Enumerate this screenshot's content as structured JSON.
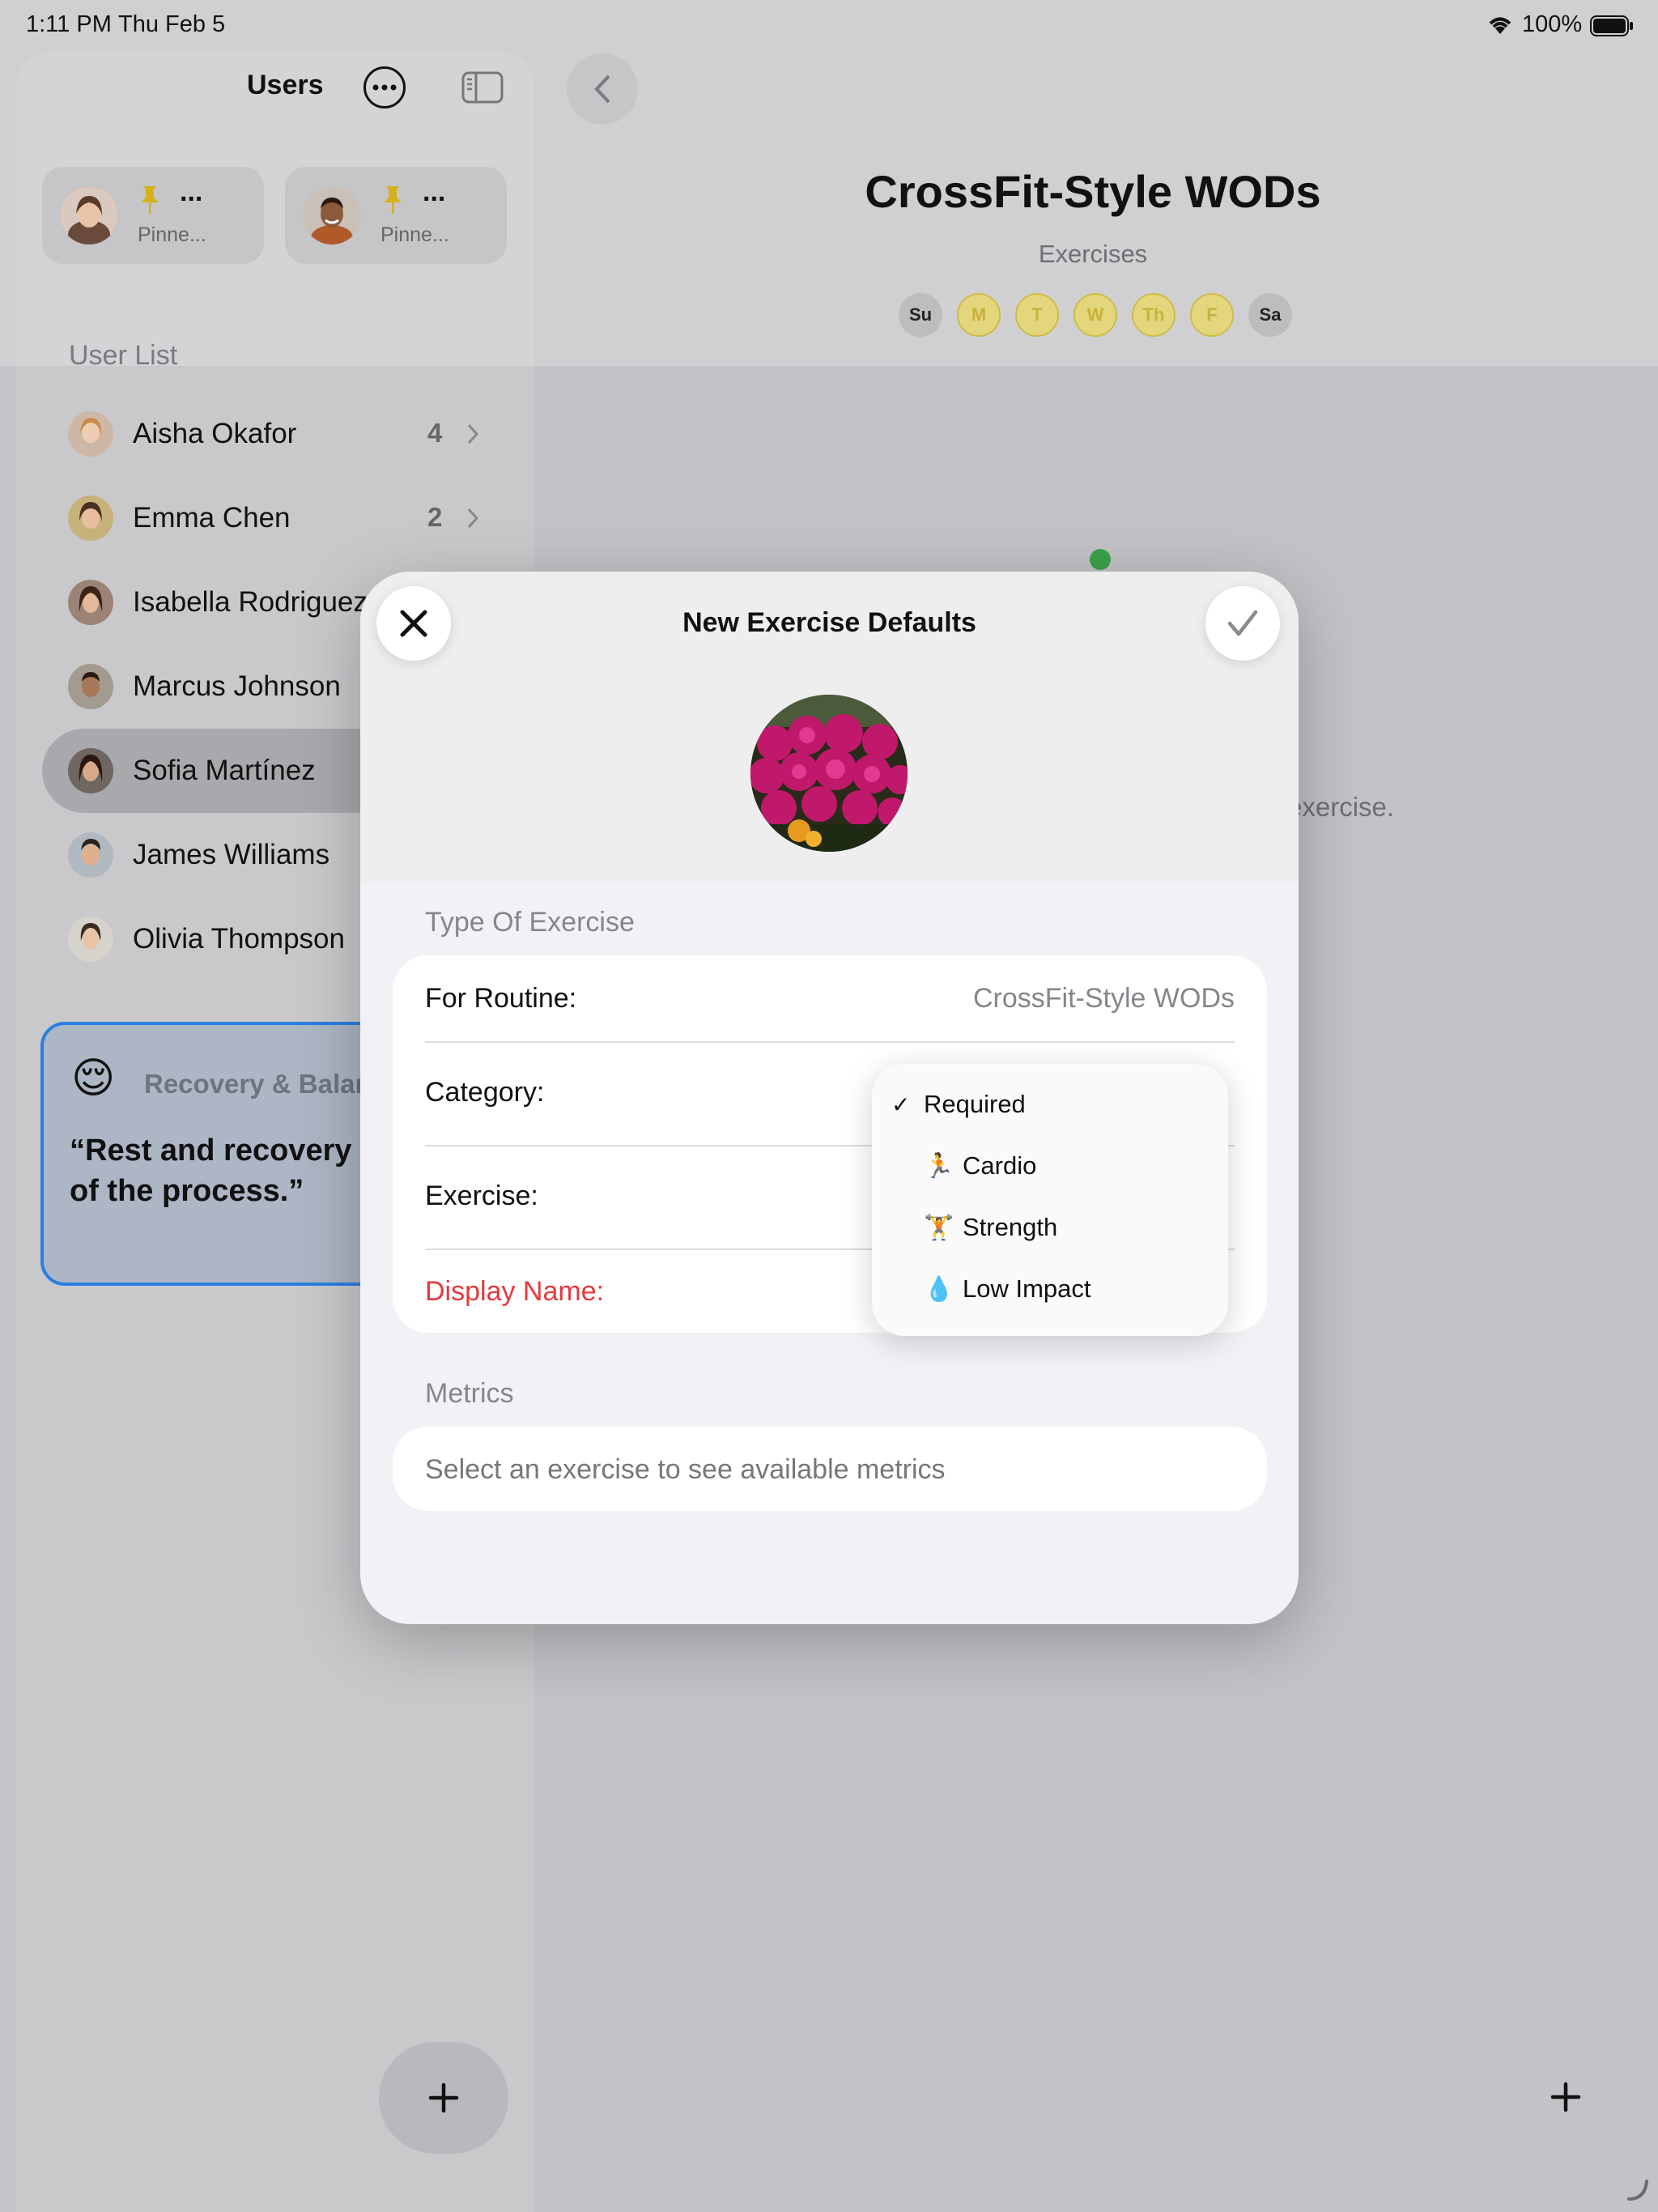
{
  "status_bar": {
    "time": "1:11 PM",
    "date": "Thu Feb 5",
    "battery": "100%"
  },
  "sidebar": {
    "title": "Users",
    "pinned": [
      {
        "name": "...",
        "label": "Pinne..."
      },
      {
        "name": "...",
        "label": "Pinne..."
      }
    ],
    "section_label": "User List",
    "users": [
      {
        "name": "Aisha Okafor",
        "count": "4"
      },
      {
        "name": "Emma Chen",
        "count": "2"
      },
      {
        "name": "Isabella Rodriguez",
        "count": ""
      },
      {
        "name": "Marcus Johnson",
        "count": ""
      },
      {
        "name": "Sofia Martínez",
        "count": ""
      },
      {
        "name": "James Williams",
        "count": ""
      },
      {
        "name": "Olivia Thompson",
        "count": ""
      }
    ],
    "quote_card": {
      "emoji": "😌",
      "title": "Recovery & Balan",
      "quote_line1": "“Rest and recovery a",
      "quote_line2": "of the process.”"
    }
  },
  "main": {
    "title": "CrossFit-Style WODs",
    "subtitle": "Exercises",
    "days": [
      "Su",
      "M",
      "T",
      "W",
      "Th",
      "F",
      "Sa"
    ],
    "partial_text": "exercise."
  },
  "modal": {
    "title": "New Exercise Defaults",
    "section_type": "Type Of Exercise",
    "routine_label": "For Routine:",
    "routine_value": "CrossFit-Style WODs",
    "category_label": "Category:",
    "exercise_label": "Exercise:",
    "display_name_label": "Display Name:",
    "section_metrics": "Metrics",
    "metrics_placeholder": "Select an exercise to see available metrics"
  },
  "category_menu": {
    "checkmark": "✓",
    "items": [
      {
        "icon": "",
        "label": "Required"
      },
      {
        "icon": "🏃",
        "label": "Cardio"
      },
      {
        "icon": "🏋️",
        "label": "Strength"
      },
      {
        "icon": "💧",
        "label": "Low Impact"
      }
    ]
  },
  "colors": {
    "accent_red": "#e5393d",
    "day_active": "#ecdd72",
    "highlight_blue": "#2a7fe0"
  }
}
